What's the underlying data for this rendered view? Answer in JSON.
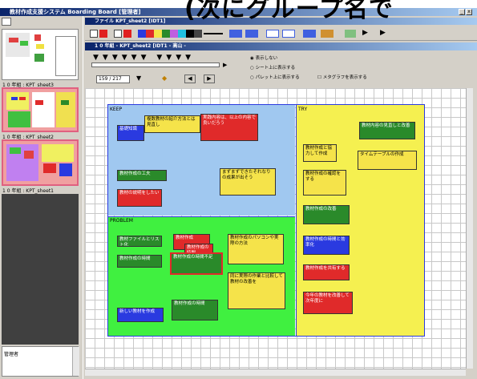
{
  "caption": "(次にグループ名で",
  "main_window": {
    "title": "教材作成支援システム Boarding Board [管理者]",
    "menu": "ファイル  KPT_sheet2 [IDT1]"
  },
  "sub_window": {
    "title": "1 0 年組 - KPT_sheet2 [IDT1 - 高山 -"
  },
  "sidebar": {
    "thumbnails": [
      {
        "label": "1 0 年組 : KPT_sheet3"
      },
      {
        "label": "1 0 年組 : KPT_sheet2"
      },
      {
        "label": "1 0 年組 : KPT_sheet1"
      }
    ],
    "bottom_label": "管理者"
  },
  "controls": {
    "page_counter": "159 / 217",
    "radio_options": [
      "表示しない",
      "シート上に表示する",
      "パレット上に表示する"
    ],
    "checkbox_label": "メタグラフを表示する"
  },
  "board": {
    "sections": [
      {
        "label": "KEEP"
      },
      {
        "label": "TRY"
      },
      {
        "label": "PROBLEM"
      }
    ],
    "notes": [
      {
        "text": "基礎知識",
        "color": "#2a3ae0"
      },
      {
        "text": "複数教材の紹介方法とは見直し",
        "color": "#f5e34a"
      },
      {
        "text": "実践内容は、以上の内容で良いだろう",
        "color": "#e02a2a"
      },
      {
        "text": "教材作成の工夫",
        "color": "#2a8a2a"
      },
      {
        "text": "教材の説明をしたい",
        "color": "#e02a2a"
      },
      {
        "text": "まずまずできたそれなりの成果が出そう",
        "color": "#f5e34a"
      },
      {
        "text": "教材ファイルとリスト化",
        "color": "#2a8a2a"
      },
      {
        "text": "教材作成の時間",
        "color": "#2a8a2a"
      },
      {
        "text": "教材作成",
        "color": "#e02a2a"
      },
      {
        "text": "教材作成の時間",
        "color": "#e02a2a"
      },
      {
        "text": "教材作成の時間不足",
        "color": "#2a8a2a"
      },
      {
        "text": "教材作成のパソコンや実際の方法",
        "color": "#f5e34a"
      },
      {
        "text": "同に実際の作業と比較して教材の改善を",
        "color": "#f5e34a"
      },
      {
        "text": "教材作成の時間",
        "color": "#2a8a2a"
      },
      {
        "text": "新しい教材を作成",
        "color": "#2a3ae0"
      },
      {
        "text": "教材作成と協力して作成",
        "color": "#f5e34a"
      },
      {
        "text": "教材内容の見直しと改善",
        "color": "#2a8a2a"
      },
      {
        "text": "タイムテーブルの作成",
        "color": "#f5e34a"
      },
      {
        "text": "教材作成の確認をする",
        "color": "#f5e34a"
      },
      {
        "text": "教材作成の改善",
        "color": "#2a8a2a"
      },
      {
        "text": "教材作成の時間と効率化",
        "color": "#2a3ae0"
      },
      {
        "text": "教材作成を共有する",
        "color": "#e02a2a"
      },
      {
        "text": "今年の教材を改善して次年度に",
        "color": "#e02a2a"
      }
    ]
  },
  "colors": {
    "keep_bg": "#a0c8f0",
    "try_bg": "#f5f050",
    "problem_bg": "#40f040",
    "titlebar_start": "#0a246a",
    "titlebar_end": "#a6caf0"
  }
}
